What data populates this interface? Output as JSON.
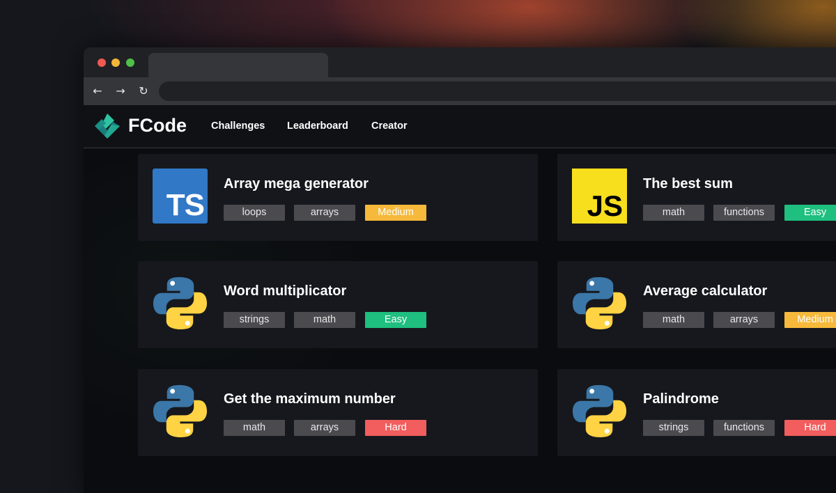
{
  "app": {
    "brand": "FCode",
    "nav": [
      {
        "label": "Challenges"
      },
      {
        "label": "Leaderboard"
      },
      {
        "label": "Creator"
      }
    ]
  },
  "browser": {
    "back_icon": "←",
    "forward_icon": "→",
    "reload_icon": "↻"
  },
  "colors": {
    "easy": "#1fbf7f",
    "medium": "#f6b93b",
    "hard": "#f25d5d",
    "tag": "#4a4a4f",
    "accent": "#1fae8f"
  },
  "challenges": [
    {
      "title": "Array mega generator",
      "language_icon": "typescript-icon",
      "language_label": "TS",
      "tags": [
        "loops",
        "arrays"
      ],
      "difficulty": "Medium"
    },
    {
      "title": "The best sum",
      "language_icon": "javascript-icon",
      "language_label": "JS",
      "tags": [
        "math",
        "functions"
      ],
      "difficulty": "Easy"
    },
    {
      "title": "Word multiplicator",
      "language_icon": "python-icon",
      "tags": [
        "strings",
        "math"
      ],
      "difficulty": "Easy"
    },
    {
      "title": "Average calculator",
      "language_icon": "python-icon",
      "tags": [
        "math",
        "arrays"
      ],
      "difficulty": "Medium"
    },
    {
      "title": "Get the maximum number",
      "language_icon": "python-icon",
      "tags": [
        "math",
        "arrays"
      ],
      "difficulty": "Hard"
    },
    {
      "title": "Palindrome",
      "language_icon": "python-icon",
      "tags": [
        "strings",
        "functions"
      ],
      "difficulty": "Hard"
    }
  ]
}
